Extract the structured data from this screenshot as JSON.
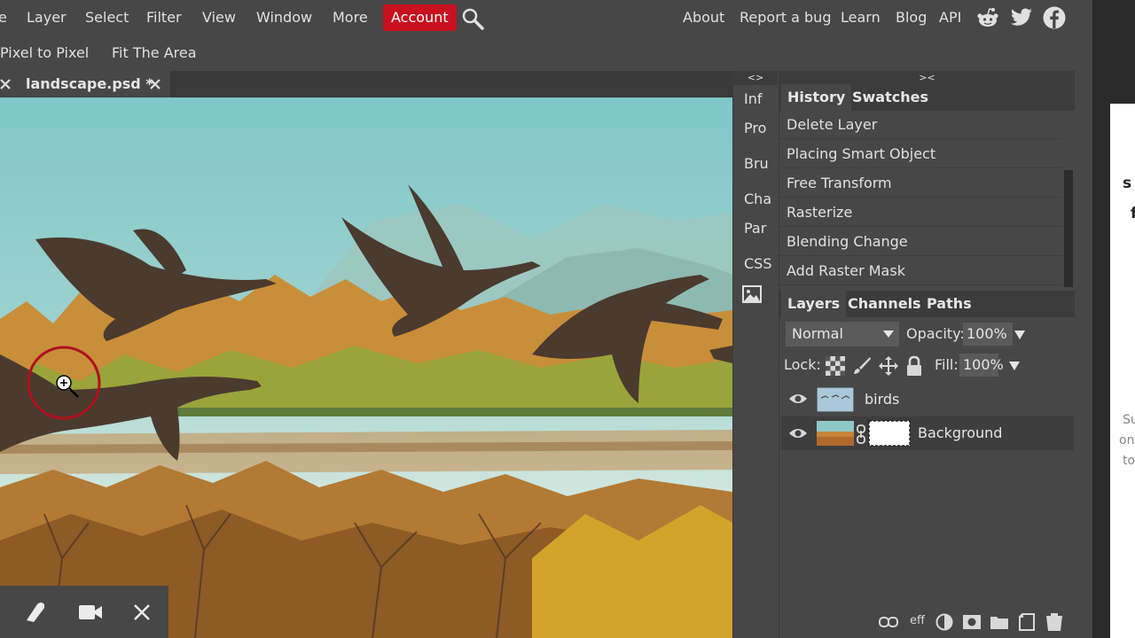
{
  "menu": {
    "items": [
      "e",
      "Layer",
      "Select",
      "Filter",
      "View",
      "Window",
      "More"
    ],
    "account": "Account",
    "right_links": [
      "About",
      "Report a bug",
      "Learn",
      "Blog",
      "API"
    ]
  },
  "options": {
    "pixel": "Pixel to Pixel",
    "fit": "Fit The Area"
  },
  "doc_tab": {
    "title": "landscape.psd *"
  },
  "mini_panel": {
    "collapse": "<>",
    "items": [
      "Inf",
      "Pro",
      "Bru",
      "Cha",
      "Par",
      "CSS"
    ]
  },
  "right_panel": {
    "collapse": "><",
    "history_tabs": [
      "History",
      "Swatches"
    ],
    "history": [
      "Delete Layer",
      "Placing Smart Object",
      "Free Transform",
      "Rasterize",
      "Blending Change",
      "Add Raster Mask"
    ],
    "layers_tabs": [
      "Layers",
      "Channels",
      "Paths"
    ],
    "blend_mode": "Normal",
    "opacity_label": "Opacity:",
    "opacity_value": "100%",
    "lock_label": "Lock:",
    "fill_label": "Fill:",
    "fill_value": "100%",
    "layers": [
      {
        "name": "birds"
      },
      {
        "name": "Background"
      }
    ],
    "effects_label": "eff"
  },
  "far_right": {
    "big": [
      "s",
      "f"
    ],
    "small": [
      "Su",
      "on",
      "to"
    ]
  },
  "colors": {
    "accent": "#c8101e",
    "panel": "#474747",
    "dark": "#3a3a3a"
  }
}
